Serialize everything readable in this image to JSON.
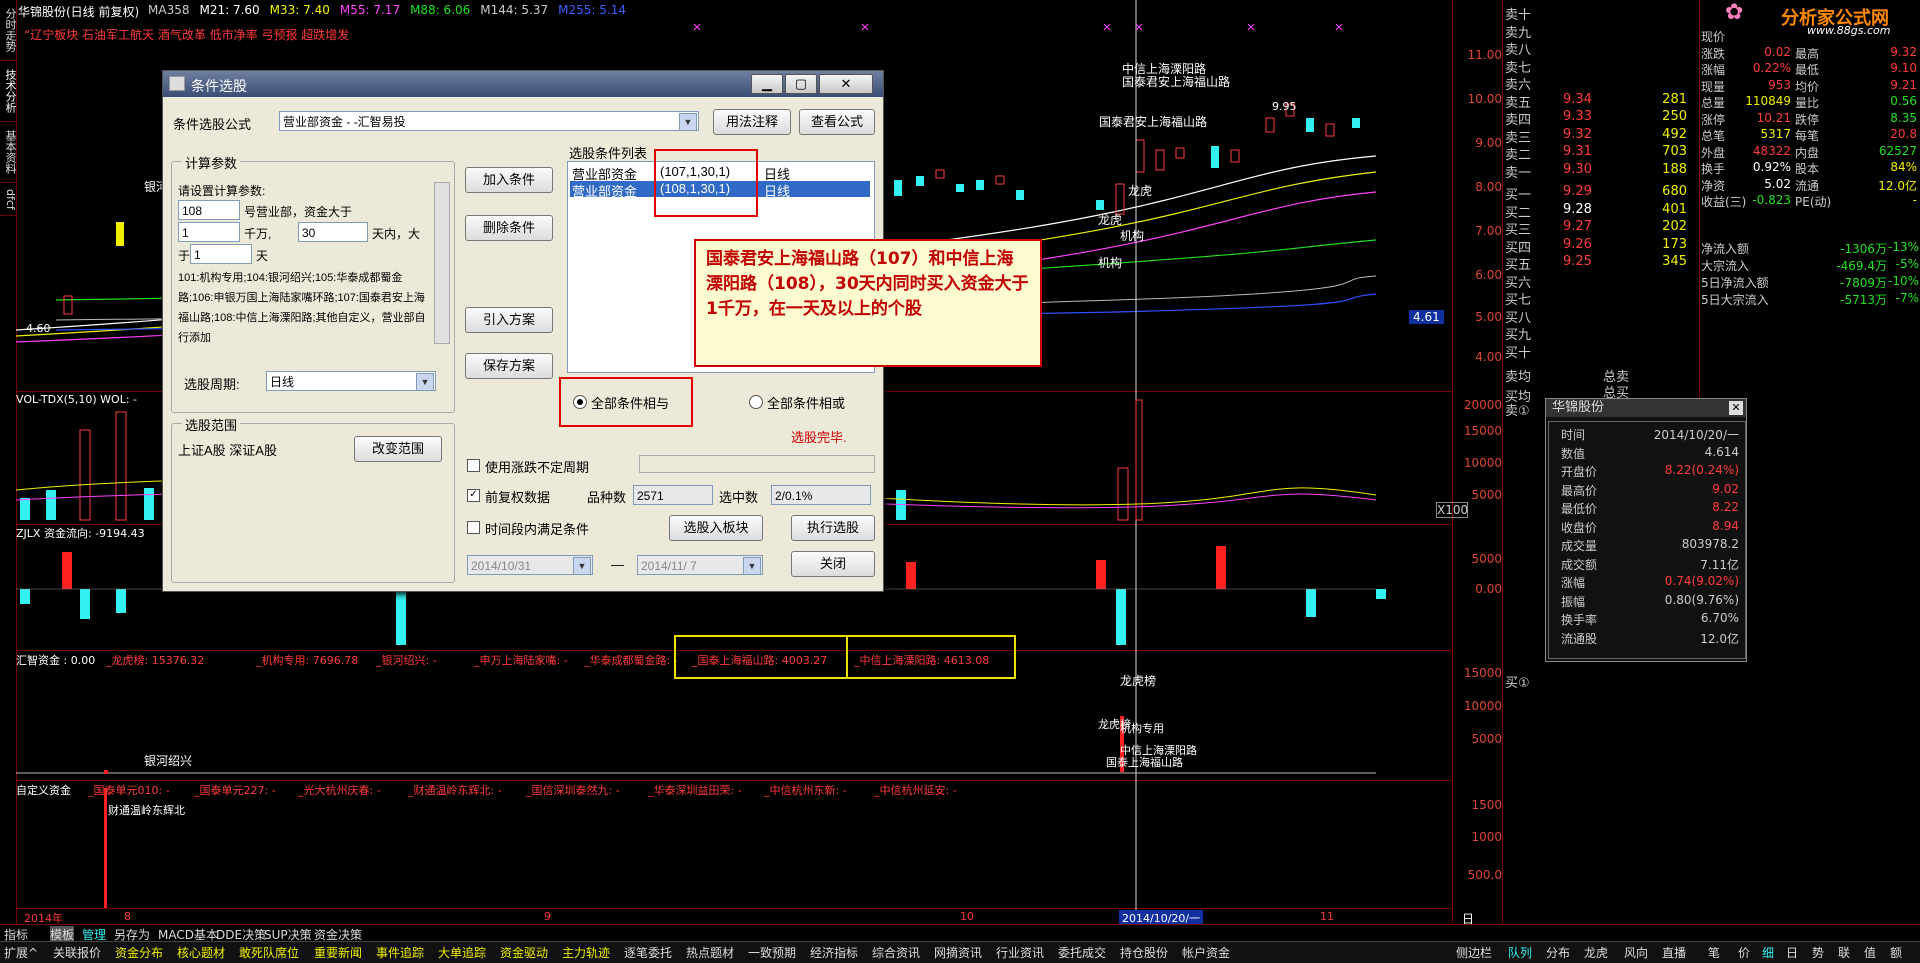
{
  "window": {
    "title_line": "华锦股份(日线 前复权)",
    "ma_items": [
      {
        "label": "MA358",
        "color": "#cccccc"
      },
      {
        "label": "M21: 7.60",
        "color": "#ffffff"
      },
      {
        "label": "M33: 7.40",
        "color": "#f0f000"
      },
      {
        "label": "M55: 7.17",
        "color": "#ff40ff"
      },
      {
        "label": "M88: 6.06",
        "color": "#20e020"
      },
      {
        "label": "M144: 5.37",
        "color": "#cccccc"
      },
      {
        "label": "M255: 5.14",
        "color": "#4060ff"
      }
    ],
    "tags_line": "“辽宁板块 石油军工航天 酒气改革 低市净率 弓预报 超跌增发"
  },
  "left_rail": [
    "分时走势",
    "技术分析",
    "基本资料",
    "dfcf"
  ],
  "price_axis": [
    "11.00",
    "10.00",
    "9.00",
    "8.00",
    "7.00",
    "6.00",
    "5.00",
    "4.00"
  ],
  "price_tag": "4.61",
  "vol_axis": [
    "20000",
    "15000",
    "10000",
    "5000",
    "X100"
  ],
  "flow_axis": [
    "5000",
    "0.00"
  ],
  "hz_axis": [
    "15000",
    "10000",
    "5000"
  ],
  "zdy_axis": [
    "1500",
    "1000",
    "500.0"
  ],
  "chart_labels": {
    "low_price": "4.60",
    "high_price": "9.95",
    "yinhe": "银河",
    "top_a": "中信上海溧阳路",
    "top_b": "国泰君安上海福山路",
    "mid_a": "国泰君安上海福山路",
    "longhu": "龙虎",
    "longhu2": "龙虎",
    "jigou": "机构",
    "jigou2": "机构",
    "vol_title": "VOL-TDX(5,10) WOL: -",
    "flow_title": "ZJLX 资金流向: -9194.43",
    "hz_title": "汇智资金 : 0.00",
    "hz_items": [
      "_龙虎榜: 15376.32",
      "_机构专用: 7696.78",
      "_银河绍兴: -",
      "_申万上海陆家嘴: -",
      "_华泰成都蜀金路: -",
      "_国泰上海福山路: 4003.27",
      "_中信上海溧阳路: 4613.08"
    ],
    "hz_yinhe": "银河绍兴",
    "hz_longhu": "龙虎榜",
    "hz_longhu2": "龙虎榜",
    "hz_jigou": "机构专用",
    "hz_zhongxin": "中信上海溧阳路",
    "hz_guotai": "国泰上海福山路",
    "zdy_title": "自定义资金",
    "zdy_items": [
      "_国泰单元010: -",
      "_国泰单元227: -",
      "_光大杭州庆春: -",
      "_财通温岭东辉北: -",
      "_国信深圳泰然九: -",
      "_华泰深圳益田荣: -",
      "_中信杭州东新: -",
      "_中信杭州延安: -"
    ],
    "zdy_caitong": "财通温岭东辉北",
    "date_axis": [
      "2014年",
      "8",
      "9",
      "10",
      "11"
    ],
    "date_cursor": "2014/10/20/一",
    "period": "日线"
  },
  "dialog": {
    "title": "条件选股",
    "formula_label": "条件选股公式",
    "formula_value": "营业部资金 - -汇智易投",
    "usage_btn": "用法注释",
    "view_btn": "查看公式",
    "calc_group": "计算参数",
    "param_label": "请设置计算参数:",
    "p1_value": "108",
    "p1_suffix": "号营业部，资金大于",
    "p2_value": "1",
    "p2_suffix": "千万,",
    "p3_value": "30",
    "p3_suffix": "天内，大",
    "p4_prefix": "于",
    "p4_value": "1",
    "p4_suffix": "天",
    "desc": "101:机构专用;104:银河绍兴;105:华泰成都蜀金路;106:申银万国上海陆家嘴环路;107:国泰君安上海福山路;108:中信上海溧阳路;其他自定义，营业部自行添加",
    "period_label": "选股周期:",
    "period_value": "日线",
    "add_btn": "加入条件",
    "del_btn": "删除条件",
    "import_btn": "引入方案",
    "save_btn": "保存方案",
    "list_title": "选股条件列表",
    "conditions": [
      {
        "name": "营业部资金",
        "params": "(107,1,30,1)",
        "period": "日线",
        "selected": false
      },
      {
        "name": "营业部资金",
        "params": "(108,1,30,1)",
        "period": "日线",
        "selected": true
      }
    ],
    "and_label": "全部条件相与",
    "or_label": "全部条件相或",
    "done_text": "选股完毕.",
    "range_group": "选股范围",
    "range_value": "上证A股 深证A股",
    "change_range_btn": "改变范围",
    "irregular_label": "使用涨跌不定周期",
    "adjust_label": "前复权数据",
    "count_label": "品种数",
    "count_value": "2571",
    "selected_label": "选中数",
    "selected_value": "2/0.1%",
    "period_cond_label": "时间段内满足条件",
    "to_block_btn": "选股入板块",
    "run_btn": "执行选股",
    "date_from": "2014/10/31",
    "date_dash": "—",
    "date_to": "2014/11/ 7",
    "close_btn": "关闭"
  },
  "callout": "国泰君安上海福山路（107）和中信上海溧阳路（108），30天内同时买入资金大于1千万，在一天及以上的个股",
  "quote": {
    "sell_labels": [
      "卖十",
      "卖九",
      "卖八",
      "卖七",
      "卖六",
      "卖五",
      "卖四",
      "卖三",
      "卖二",
      "卖一"
    ],
    "sell_prices": [
      "",
      "",
      "",
      "",
      "",
      "9.34",
      "9.33",
      "9.32",
      "9.31",
      "9.30"
    ],
    "sell_vols": [
      "",
      "",
      "",
      "",
      "",
      "281",
      "250",
      "492",
      "703",
      "188"
    ],
    "buy_labels": [
      "买一",
      "买二",
      "买三",
      "买四",
      "买五",
      "买六",
      "买七",
      "买八",
      "买九",
      "买十"
    ],
    "buy_prices": [
      "9.29",
      "9.28",
      "9.27",
      "9.26",
      "9.25",
      "",
      "",
      "",
      "",
      ""
    ],
    "buy_vols": [
      "680",
      "401",
      "202",
      "173",
      "345",
      "",
      "",
      "",
      "",
      ""
    ],
    "avg_sell": "卖均",
    "avg_buy": "买均",
    "total_sell": "总卖",
    "total_buy": "总买",
    "sell1_bottom": "卖①",
    "buy1_bottom": "买①",
    "logo_text": "分析家公式网",
    "logo_url": "www.88gs.com",
    "stats": [
      {
        "k": "现价",
        "v": "",
        "k2": "",
        "v2": ""
      },
      {
        "k": "涨跌",
        "v": "0.02",
        "k2": "最高",
        "v2": "9.32"
      },
      {
        "k": "涨幅",
        "v": "0.22%",
        "k2": "最低",
        "v2": "9.10"
      },
      {
        "k": "现量",
        "v": "953",
        "k2": "均价",
        "v2": "9.21"
      },
      {
        "k": "总量",
        "v": "110849",
        "k2": "量比",
        "v2": "0.56"
      },
      {
        "k": "涨停",
        "v": "10.21",
        "k2": "跌停",
        "v2": "8.35"
      },
      {
        "k": "总笔",
        "v": "5317",
        "k2": "每笔",
        "v2": "20.8"
      },
      {
        "k": "外盘",
        "v": "48322",
        "k2": "内盘",
        "v2": "62527"
      },
      {
        "k": "换手",
        "v": "0.92%",
        "k2": "股本",
        "v2": "84%"
      },
      {
        "k": "净资",
        "v": "5.02",
        "k2": "流通",
        "v2": "12.0亿"
      },
      {
        "k": "收益(三)",
        "v": "-0.823",
        "k2": "PE(动)",
        "v2": "-"
      }
    ],
    "flows": [
      {
        "k": "净流入额",
        "v": "-1306万",
        "p": "-13%"
      },
      {
        "k": "大宗流入",
        "v": "-469.4万",
        "p": "-5%"
      },
      {
        "k": "5日净流入额",
        "v": "-7809万",
        "p": "-10%"
      },
      {
        "k": "5日大宗流入",
        "v": "-5713万",
        "p": "-7%"
      }
    ]
  },
  "info_popup": {
    "title": "华锦股份",
    "rows": [
      {
        "k": "时间",
        "v": "2014/10/20/一",
        "c": "#ccc"
      },
      {
        "k": "数值",
        "v": "4.614",
        "c": "#ccc"
      },
      {
        "k": "开盘价",
        "v": "8.22(0.24%)",
        "c": "#ff3b3b"
      },
      {
        "k": "最高价",
        "v": "9.02",
        "c": "#ff3b3b"
      },
      {
        "k": "最低价",
        "v": "8.22",
        "c": "#ff3b3b"
      },
      {
        "k": "收盘价",
        "v": "8.94",
        "c": "#ff3b3b"
      },
      {
        "k": "成交量",
        "v": "803978.2",
        "c": "#ccc"
      },
      {
        "k": "成交额",
        "v": "7.11亿",
        "c": "#ccc"
      },
      {
        "k": "涨幅",
        "v": "0.74(9.02%)",
        "c": "#ff3b3b"
      },
      {
        "k": "振幅",
        "v": "0.80(9.76%)",
        "c": "#ccc"
      },
      {
        "k": "换手率",
        "v": "6.70%",
        "c": "#ccc"
      },
      {
        "k": "流通股",
        "v": "12.0亿",
        "c": "#ccc"
      }
    ]
  },
  "tabbar": [
    "指标",
    "模板",
    "管理",
    "另存为",
    "MACD基本",
    "DDE决策",
    "SUP决策",
    "资金决策"
  ],
  "menubar": [
    "扩展^",
    "关联报价",
    "资金分布",
    "核心题材",
    "敢死队席位",
    "重要新闻",
    "事件追踪",
    "大单追踪",
    "资金驱动",
    "主力轨迹",
    "逐笔委托",
    "热点题材",
    "一致预期",
    "经济指标",
    "综合资讯",
    "网摘资讯",
    "行业资讯",
    "委托成交",
    "持仓股份",
    "帐户资金"
  ],
  "right_tabs": [
    "侧边栏",
    "队列",
    "分布",
    "龙虎",
    "风向",
    "直播",
    "笔",
    "价",
    "细",
    "日",
    "势",
    "联",
    "值",
    "额"
  ],
  "right_tabs_active": [
    "队列",
    "细"
  ]
}
